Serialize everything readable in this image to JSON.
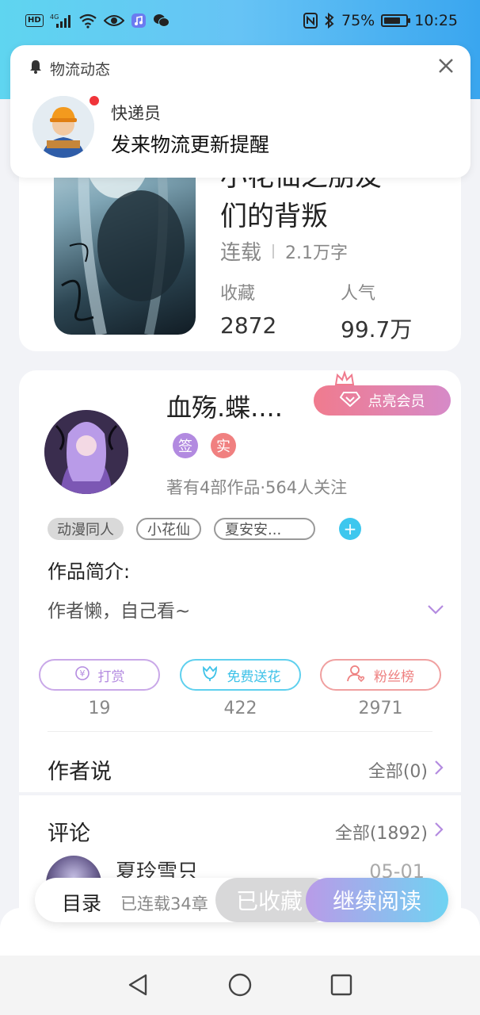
{
  "status_bar": {
    "left_icons": [
      "hd-icon",
      "signal-4g-icon",
      "wifi-icon",
      "eye-icon",
      "music-app-icon",
      "wechat-icon"
    ],
    "hd_label": "HD",
    "network_label": "4G",
    "right_icons": [
      "nfc-icon",
      "bluetooth-icon",
      "battery-icon"
    ],
    "battery_percent": "75%",
    "battery_level": 0.75,
    "time": "10:25"
  },
  "notification": {
    "app_name": "物流动态",
    "sender": "快递员",
    "message": "发来物流更新提醒",
    "icons": [
      "bell-icon",
      "close-icon",
      "courier-avatar-icon"
    ]
  },
  "book": {
    "title_line1": "小花仙之朋友",
    "title_line2": "们的背叛",
    "status": "连载",
    "word_count": "2.1万字",
    "stats": [
      {
        "label": "收藏",
        "value": "2872"
      },
      {
        "label": "人气",
        "value": "99.7万"
      }
    ]
  },
  "author": {
    "name": "血殇.蝶....",
    "vip_button": "点亮会员",
    "badges": [
      {
        "label": "签",
        "color": "#b28ae0"
      },
      {
        "label": "实",
        "color": "#f08080"
      }
    ],
    "stats": "著有4部作品·564人关注",
    "tags": [
      "动漫同人",
      "小花仙",
      "夏安安..."
    ],
    "intro_label": "作品简介:",
    "intro_text": "作者懒，自己看~"
  },
  "actions": [
    {
      "label": "打赏",
      "count": "19",
      "color": "#c9a8e8",
      "text_color": "#b48be0",
      "icon": "coin-icon"
    },
    {
      "label": "免费送花",
      "count": "422",
      "color": "#5fd0ee",
      "text_color": "#3ec2e8",
      "icon": "flower-icon"
    },
    {
      "label": "粉丝榜",
      "count": "2971",
      "color": "#f0a0a0",
      "text_color": "#ee8080",
      "icon": "fan-user-icon"
    }
  ],
  "author_says": {
    "title": "作者说",
    "more": "全部(0)"
  },
  "comments": {
    "title": "评论",
    "more": "全部(1892)",
    "first": {
      "name": "夏玲雪只",
      "date": "05-01"
    }
  },
  "bottom_bar": {
    "toc_label": "目录",
    "toc_progress": "已连载34章",
    "collected_label": "已收藏",
    "read_label": "继续阅读"
  },
  "nav": [
    "back-icon",
    "home-icon",
    "recents-icon"
  ],
  "colors": {
    "accent_purple": "#b48be0",
    "accent_cyan": "#3ec2e8",
    "vip_gradient_start": "#f07b8e",
    "vip_gradient_end": "#d68ac8"
  }
}
